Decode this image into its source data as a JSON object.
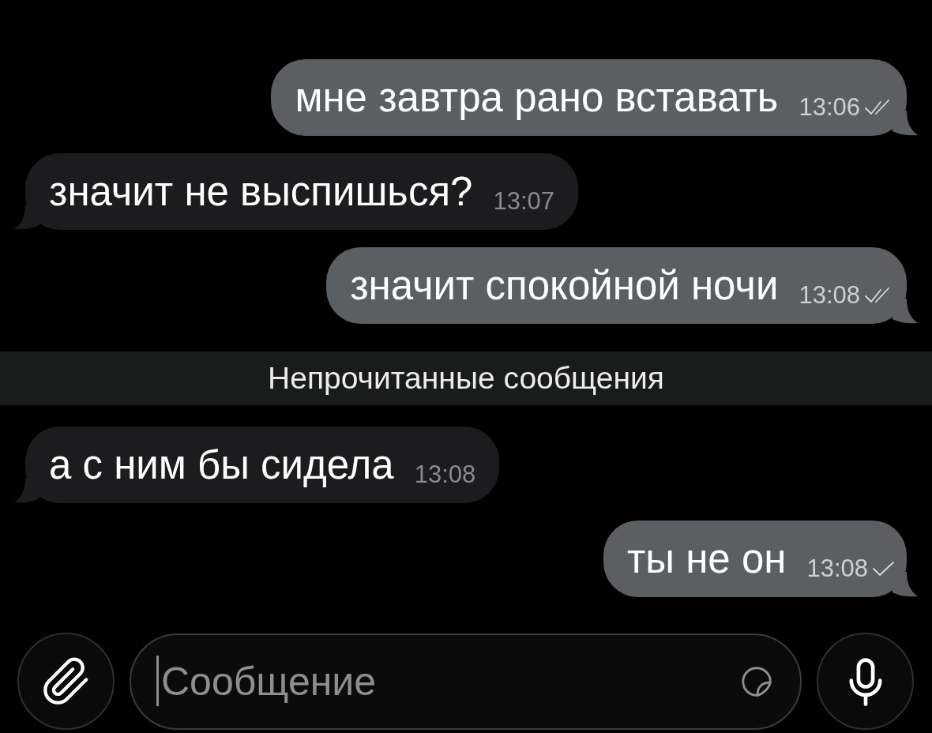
{
  "messages": [
    {
      "kind": "outgoing",
      "text": "мне завтра рано вставать",
      "time": "13:06",
      "read": true
    },
    {
      "kind": "incoming",
      "text": "значит не выспишься?",
      "time": "13:07"
    },
    {
      "kind": "outgoing",
      "text": "значит спокойной ночи",
      "time": "13:08",
      "read": true
    },
    {
      "kind": "divider",
      "text": "Непрочитанные сообщения"
    },
    {
      "kind": "incoming",
      "text": "а с ним бы сидела",
      "time": "13:08"
    },
    {
      "kind": "outgoing",
      "text": "ты не он",
      "time": "13:08",
      "read": false
    }
  ],
  "composer": {
    "placeholder": "Сообщение"
  }
}
